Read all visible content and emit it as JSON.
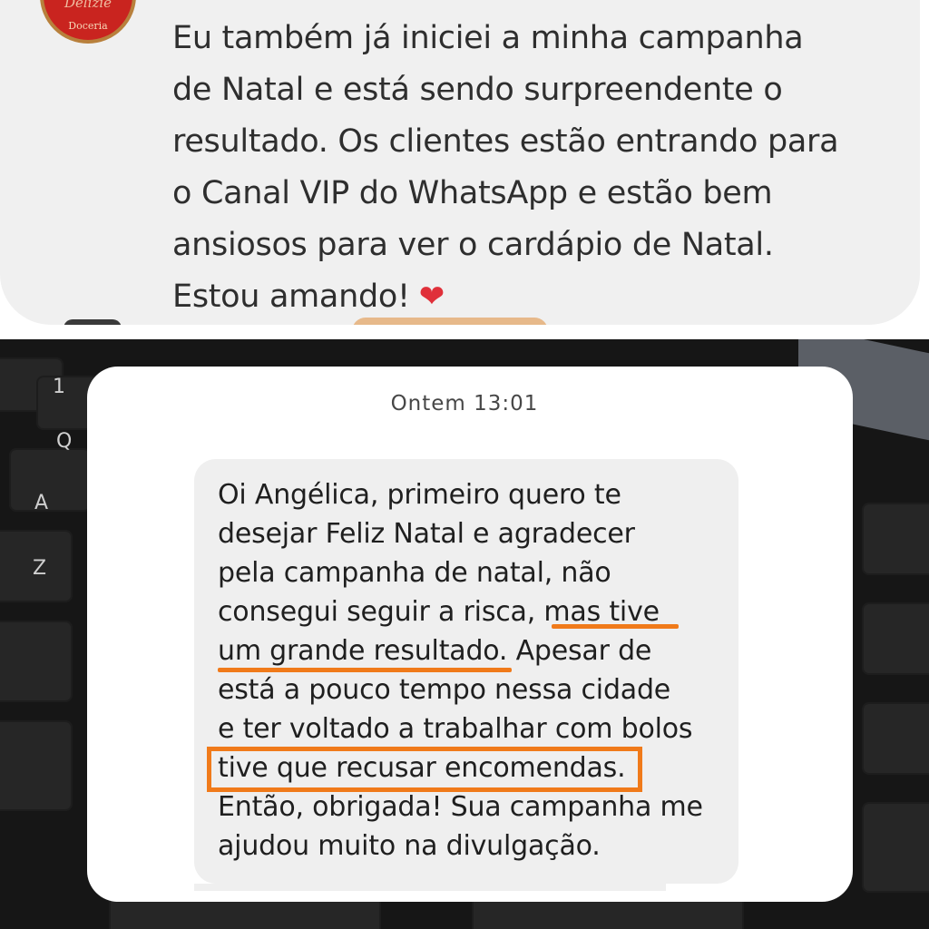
{
  "top_comment": {
    "avatar_logo_script": "Delizie",
    "avatar_logo_sub": "Doceria",
    "lines": [
      "Eu também já iniciei a minha campanha",
      "de Natal e está sendo surpreendente o",
      "resultado. Os clientes estão entrando para",
      "o Canal VIP do WhatsApp e estão bem",
      "ansiosos para ver o cardápio de Natal.",
      "Estou amando!"
    ],
    "emoji": "❤"
  },
  "chat": {
    "timestamp": "Ontem 13:01",
    "lines": [
      "Oi Angélica, primeiro quero te",
      "desejar Feliz  Natal e agradecer",
      "pela campanha de natal, não",
      "consegui seguir a risca, mas tive",
      "um grande resultado. Apesar de",
      "está a pouco tempo nessa cidade",
      "e ter voltado a trabalhar com bolos",
      "tive que recusar encomendas.",
      "Então, obrigada! Sua campanha me",
      "ajudou muito na divulgação."
    ]
  },
  "highlight_color": "#f07a1a",
  "keyboard_keys": [
    "A",
    "Z",
    "Q",
    "1"
  ]
}
